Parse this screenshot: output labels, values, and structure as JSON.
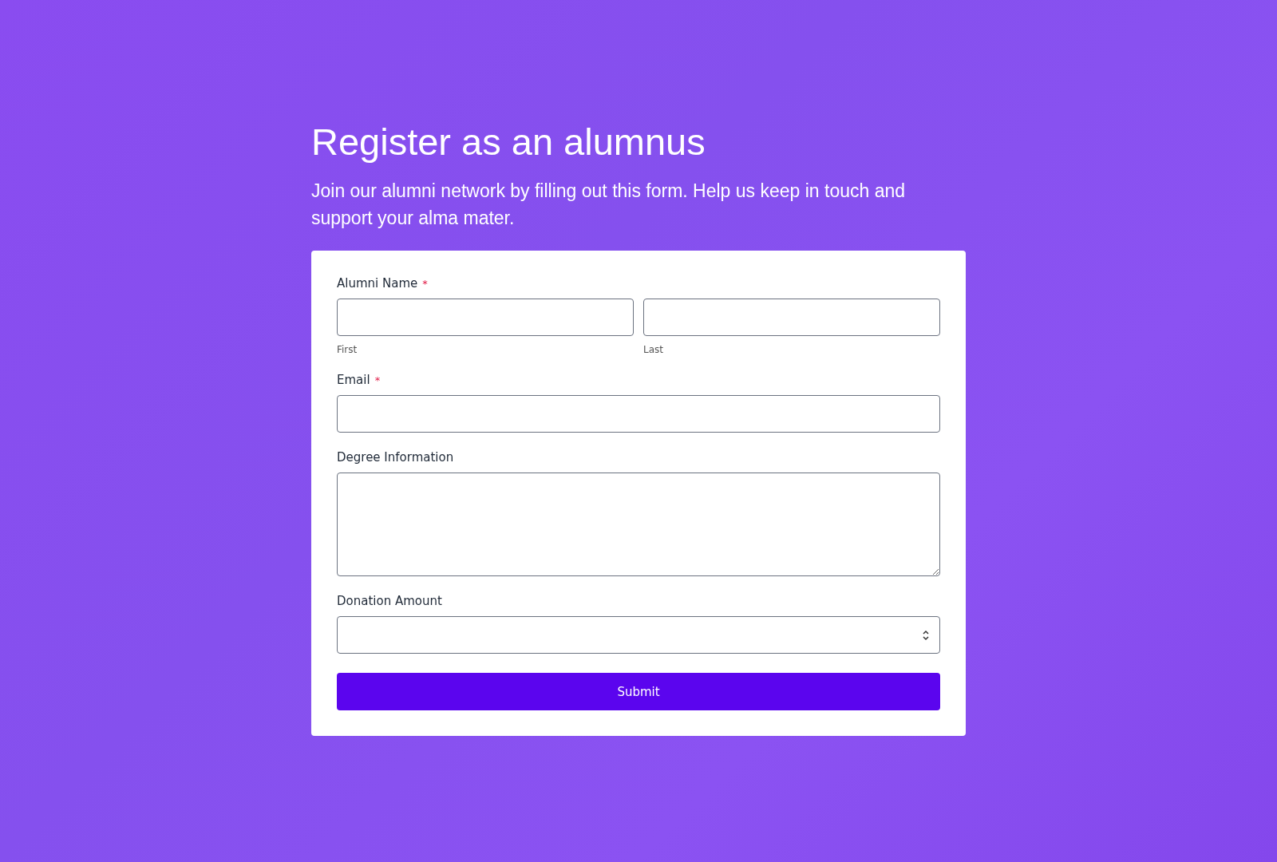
{
  "heading": "Register as an alumnus",
  "intro": "Join our alumni network by filling out this form. Help us keep in touch and support your alma mater.",
  "fields": [
    {
      "kind": "name",
      "label": "Alumni Name",
      "marker": "*",
      "parts": [
        {
          "sublabel": "First"
        },
        {
          "sublabel": "Last"
        }
      ]
    },
    {
      "kind": "text",
      "label": "Email",
      "marker": "*"
    },
    {
      "kind": "textarea",
      "label": "Degree Information"
    },
    {
      "kind": "select",
      "label": "Donation Amount"
    }
  ],
  "submit": "Submit"
}
